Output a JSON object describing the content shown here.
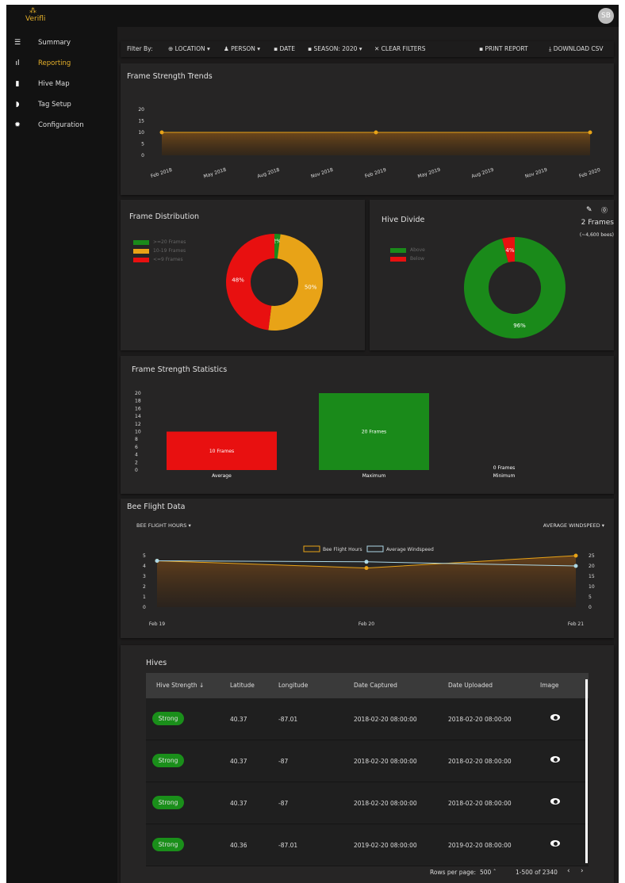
{
  "app": {
    "logo": "Verifli",
    "user_initials": "SB"
  },
  "nav": [
    {
      "icon": "list-icon",
      "label": "Summary"
    },
    {
      "icon": "bar-chart-icon",
      "label": "Reporting",
      "active": true
    },
    {
      "icon": "map-icon",
      "label": "Hive Map"
    },
    {
      "icon": "tag-icon",
      "label": "Tag Setup"
    },
    {
      "icon": "gear-icon",
      "label": "Configuration"
    }
  ],
  "filters": {
    "label": "Filter By:",
    "location": "LOCATION",
    "person": "PERSON",
    "date": "DATE",
    "season": "SEASON: 2020",
    "clear": "CLEAR FILTERS",
    "print": "PRINT REPORT",
    "download": "DOWNLOAD CSV"
  },
  "trends": {
    "title": "Frame Strength Trends"
  },
  "distribution": {
    "title": "Frame Distribution"
  },
  "divide": {
    "title": "Hive Divide",
    "frames": "2 Frames",
    "bees": "(~4,600 bees)"
  },
  "statistics": {
    "title": "Frame Strength Statistics"
  },
  "flight": {
    "title": "Bee Flight Data",
    "left_select": "BEE FLIGHT HOURS",
    "right_select": "AVERAGE WINDSPEED"
  },
  "hives": {
    "title": "Hives",
    "columns": [
      "Hive Strength",
      "Latitude",
      "Longitude",
      "Date Captured",
      "Date Uploaded",
      "Image"
    ],
    "rows": [
      [
        "Strong",
        "40.37",
        "-87.01",
        "2018-02-20 08:00:00",
        "2018-02-20 08:00:00"
      ],
      [
        "Strong",
        "40.37",
        "-87",
        "2018-02-20 08:00:00",
        "2018-02-20 08:00:00"
      ],
      [
        "Strong",
        "40.37",
        "-87",
        "2018-02-20 08:00:00",
        "2018-02-20 08:00:00"
      ],
      [
        "Strong",
        "40.36",
        "-87.01",
        "2019-02-20 08:00:00",
        "2019-02-20 08:00:00"
      ]
    ],
    "rows_per_page_label": "Rows per page:",
    "rows_per_page": "500",
    "range": "1-500 of 2340"
  },
  "chart_data": [
    {
      "type": "area",
      "title": "Frame Strength Trends",
      "x": [
        "Feb 2018",
        "Feb 2019",
        "Feb 2020"
      ],
      "categories": [
        "Feb 2018",
        "May 2018",
        "Aug 2018",
        "Nov 2018",
        "Feb 2019",
        "May 2019",
        "Aug 2019",
        "Nov 2019",
        "Feb 2020"
      ],
      "values": [
        10,
        10,
        10
      ],
      "yticks": [
        0,
        5,
        10,
        15,
        20
      ],
      "ylim": [
        0,
        20
      ],
      "color": "#e8a317"
    },
    {
      "type": "pie",
      "title": "Frame Distribution",
      "labels": [
        ">=20 Frames",
        "10-19 Frames",
        "<=9 Frames"
      ],
      "values": [
        2,
        50,
        48
      ],
      "colors": [
        "#1a8a1a",
        "#e8a317",
        "#e81010"
      ]
    },
    {
      "type": "pie",
      "title": "Hive Divide",
      "labels": [
        "Above",
        "Below"
      ],
      "values": [
        96,
        4
      ],
      "colors": [
        "#1a8a1a",
        "#e81010"
      ]
    },
    {
      "type": "bar",
      "title": "Frame Strength Statistics",
      "categories": [
        "Average",
        "Maximum",
        "Minimum"
      ],
      "values": [
        10,
        20,
        0
      ],
      "labels": [
        "10 Frames",
        "20 Frames",
        "0 Frames"
      ],
      "colors": [
        "#e81010",
        "#1a8a1a",
        "#1a8a1a"
      ],
      "yticks": [
        0,
        2,
        4,
        6,
        8,
        10,
        12,
        14,
        16,
        18,
        20
      ],
      "ylim": [
        0,
        20
      ]
    },
    {
      "type": "line",
      "title": "Bee Flight Data",
      "x": [
        "Feb 19",
        "Feb 20",
        "Feb 21"
      ],
      "series": [
        {
          "name": "Bee Flight Hours",
          "values": [
            4.5,
            3.8,
            5
          ],
          "color": "#e8a317",
          "axis": "left"
        },
        {
          "name": "Average Windspeed",
          "values": [
            22.5,
            22,
            20
          ],
          "color": "#add8e6",
          "axis": "right"
        }
      ],
      "yticks_left": [
        0,
        1,
        2,
        3,
        4,
        5
      ],
      "yticks_right": [
        0,
        5,
        10,
        15,
        20,
        25
      ],
      "ylim_left": [
        0,
        5
      ],
      "ylim_right": [
        0,
        25
      ]
    }
  ]
}
